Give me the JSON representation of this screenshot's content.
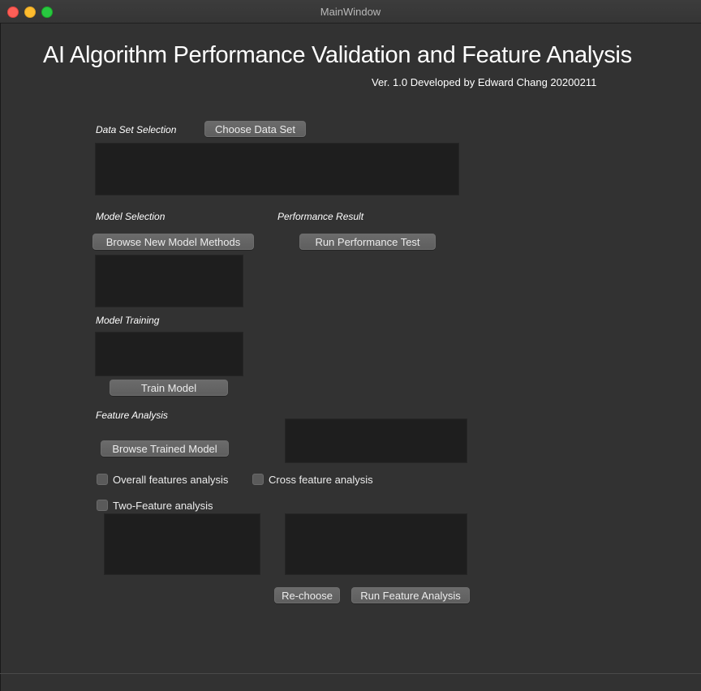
{
  "window": {
    "title": "MainWindow"
  },
  "header": {
    "title": "AI Algorithm Performance Validation and Feature Analysis",
    "subtitle": "Ver. 1.0 Developed by Edward Chang 20200211"
  },
  "data_set": {
    "label": "Data Set Selection",
    "choose_button": "Choose Data Set"
  },
  "model_selection": {
    "label": "Model Selection",
    "browse_button": "Browse New Model Methods"
  },
  "performance": {
    "label": "Performance Result",
    "run_button": "Run Performance Test"
  },
  "training": {
    "label": "Model Training",
    "train_button": "Train Model"
  },
  "feature_analysis": {
    "label": "Feature Analysis",
    "browse_button": "Browse Trained Model",
    "options": [
      {
        "label": "Overall features analysis",
        "checked": false
      },
      {
        "label": "Cross feature analysis",
        "checked": false
      },
      {
        "label": "Two-Feature analysis",
        "checked": false
      }
    ],
    "rechoose_button": "Re-choose",
    "run_button": "Run Feature Analysis"
  },
  "colors": {
    "window_bg": "#323232",
    "panel_bg": "#1e1e1e",
    "button_bg": "#646464",
    "text": "#ffffff"
  }
}
